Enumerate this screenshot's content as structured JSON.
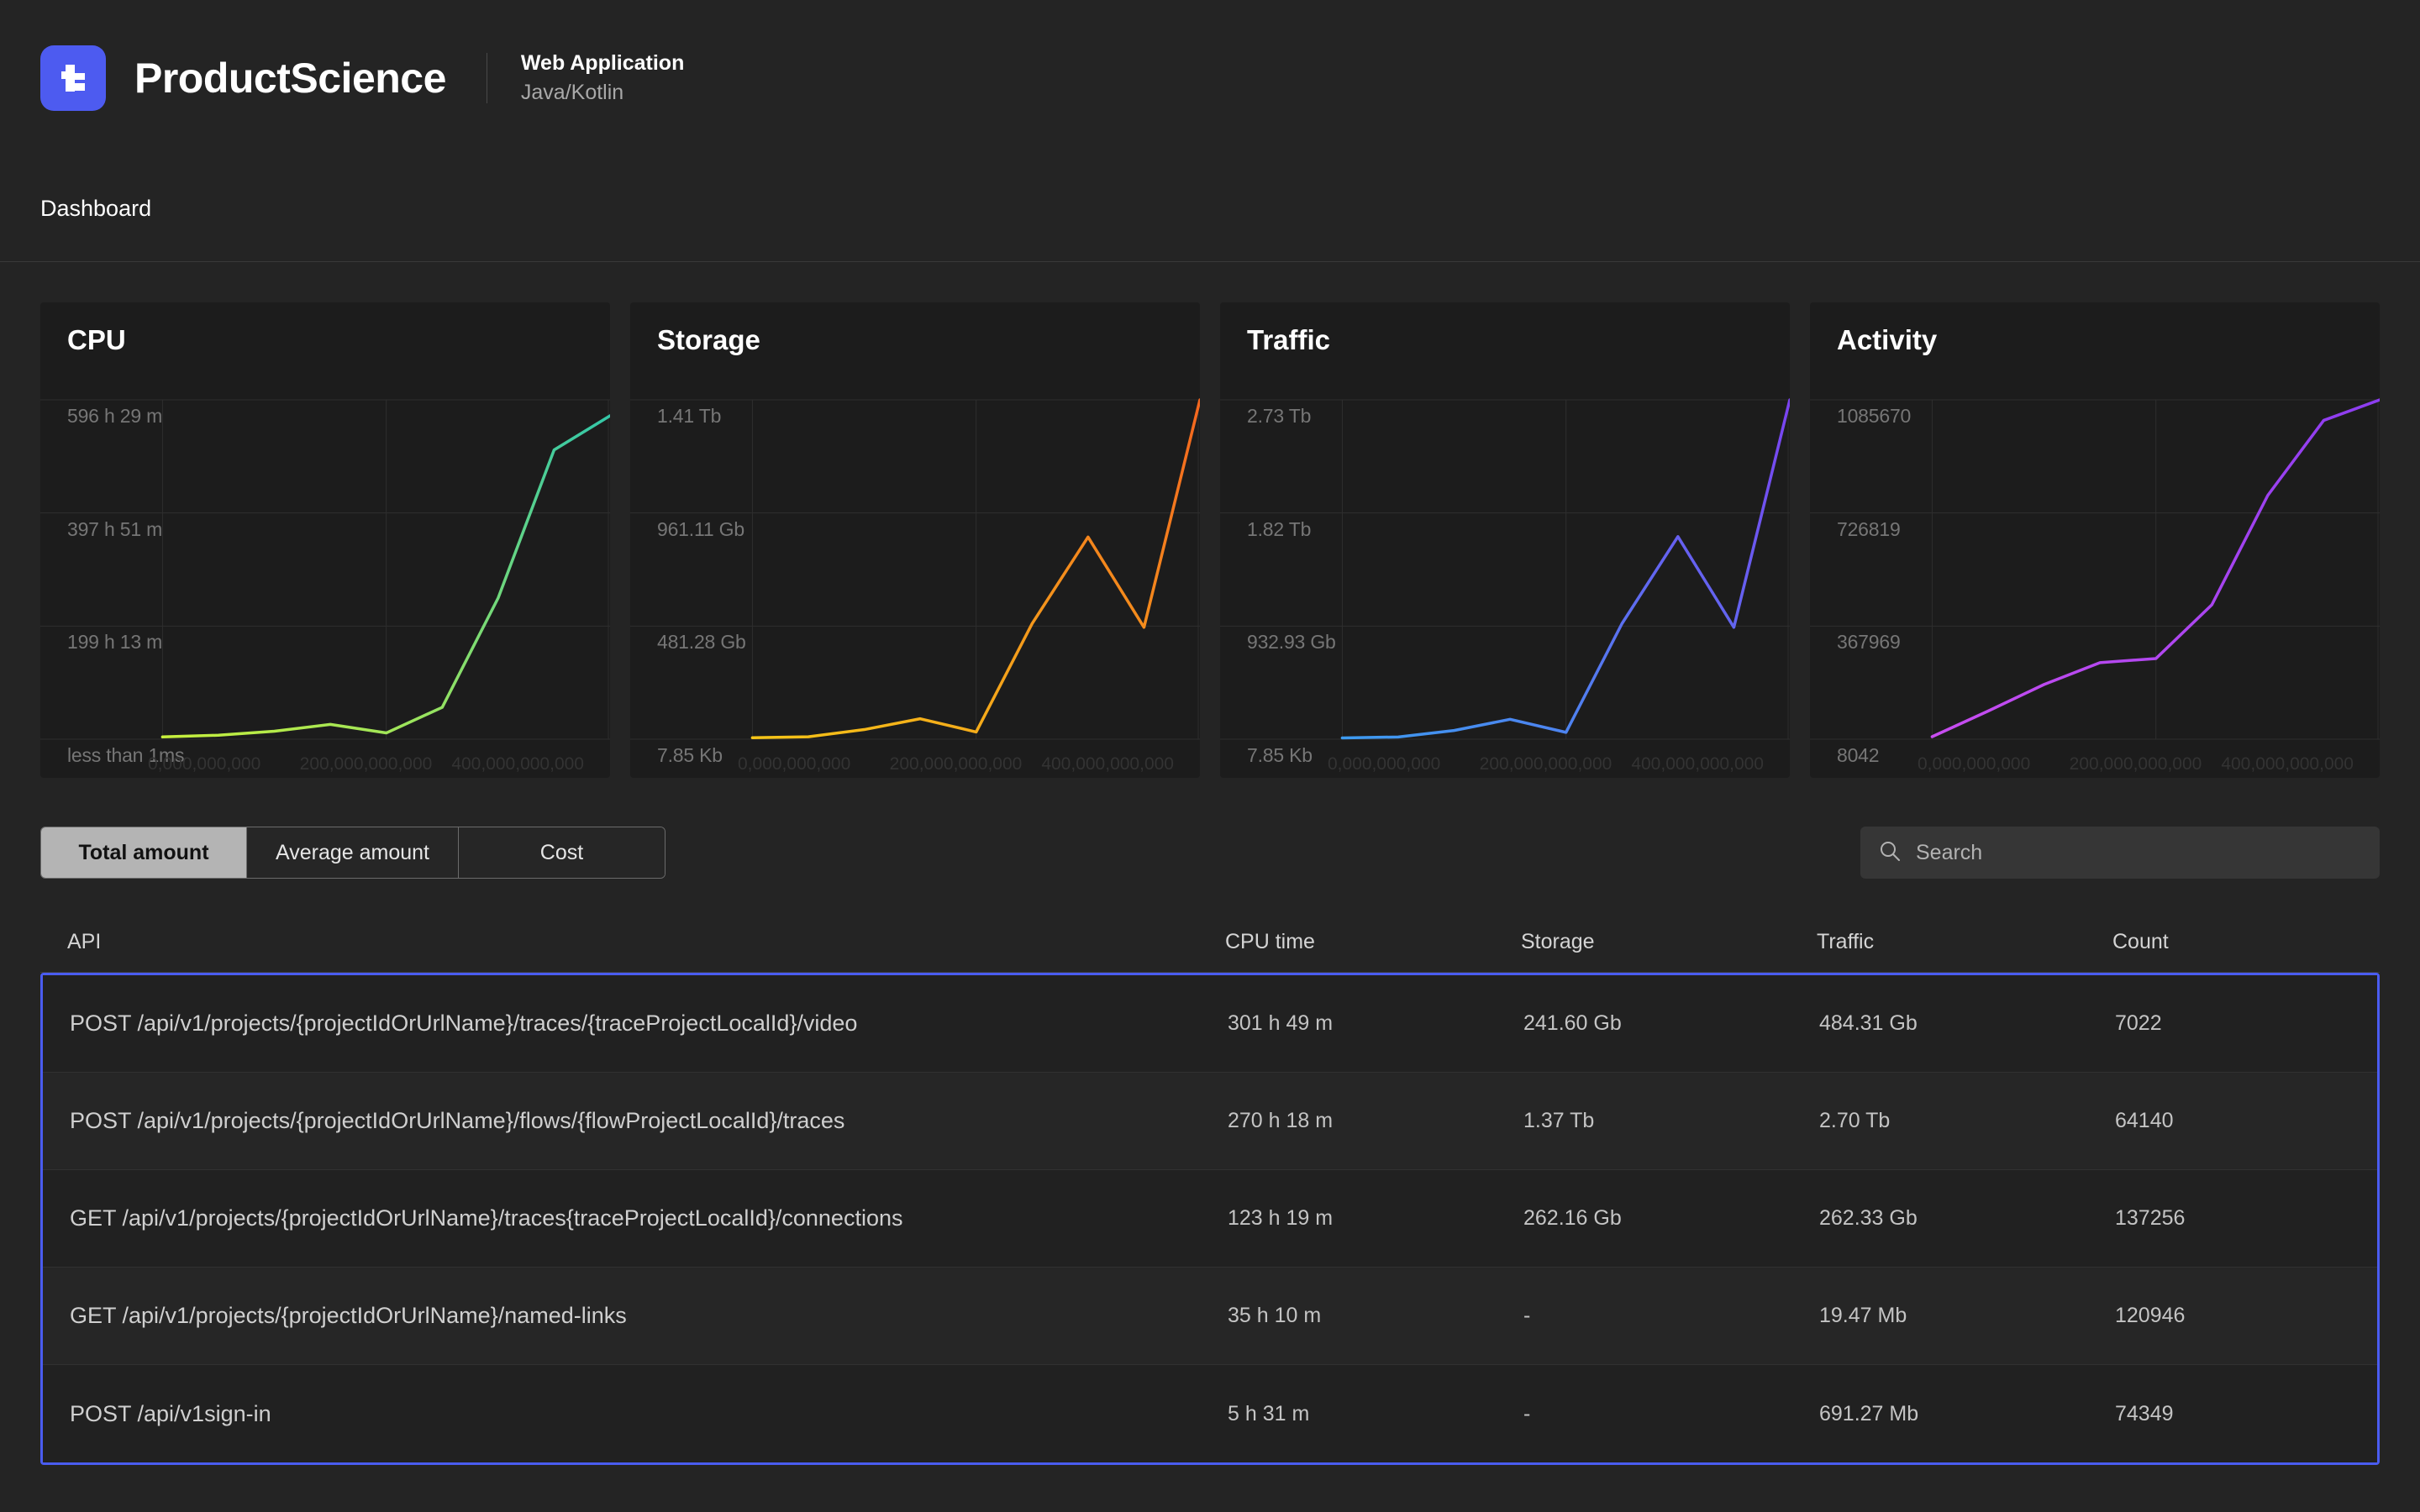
{
  "header": {
    "logo_icon": "productscience-logo-icon",
    "brand": "ProductScience",
    "app_type": "Web Application",
    "tech_stack": "Java/Kotlin"
  },
  "breadcrumb": {
    "label": "Dashboard"
  },
  "colors": {
    "accent": "#4d5bf0",
    "selection_border": "#4a5cf0",
    "page_bg": "#242424",
    "card_bg": "#1c1c1c"
  },
  "chart_data": [
    {
      "type": "line",
      "title": "CPU",
      "ylabel": "",
      "xlabel": "",
      "y_ticks": [
        "less than 1ms",
        "199 h 13 m",
        "397 h 51 m",
        "596 h 29 m"
      ],
      "x_ticks": [
        "0,000,000,000",
        "200,000,000,000",
        "400,000,000,000"
      ],
      "line_start_color": "#c8f03c",
      "line_end_color": "#34c7a8",
      "grid": true,
      "x": [
        0,
        1,
        2,
        3,
        4,
        5,
        6,
        7,
        8
      ],
      "values": [
        4,
        7,
        14,
        26,
        11,
        56,
        248,
        508,
        568
      ],
      "ylim": [
        0,
        596
      ]
    },
    {
      "type": "line",
      "title": "Storage",
      "ylabel": "",
      "xlabel": "",
      "y_ticks": [
        "7.85 Kb",
        "481.28 Gb",
        "961.11 Gb",
        "1.41 Tb"
      ],
      "x_ticks": [
        "0,000,000,000",
        "200,000,000,000",
        "400,000,000,000"
      ],
      "line_start_color": "#f5c518",
      "line_end_color": "#f4661f",
      "grid": true,
      "x": [
        0,
        1,
        2,
        3,
        4,
        5,
        6,
        7,
        8
      ],
      "values": [
        6,
        10,
        40,
        85,
        30,
        480,
        840,
        465,
        1410
      ],
      "ylim": [
        0,
        1410
      ]
    },
    {
      "type": "line",
      "title": "Traffic",
      "ylabel": "",
      "xlabel": "",
      "y_ticks": [
        "7.85 Kb",
        "932.93 Gb",
        "1.82 Tb",
        "2.73 Tb"
      ],
      "x_ticks": [
        "0,000,000,000",
        "200,000,000,000",
        "400,000,000,000"
      ],
      "line_start_color": "#3d9bf0",
      "line_end_color": "#7b42f0",
      "grid": true,
      "x": [
        0,
        1,
        2,
        3,
        4,
        5,
        6,
        7,
        8
      ],
      "values": [
        10,
        18,
        70,
        160,
        55,
        930,
        1630,
        900,
        2730
      ],
      "ylim": [
        0,
        2730
      ]
    },
    {
      "type": "line",
      "title": "Activity",
      "ylabel": "",
      "xlabel": "",
      "y_ticks": [
        "8042",
        "367969",
        "726819",
        "1085670"
      ],
      "x_ticks": [
        "0,000,000,000",
        "200,000,000,000",
        "400,000,000,000"
      ],
      "line_start_color": "#c84df0",
      "line_end_color": "#8c3df0",
      "grid": true,
      "x": [
        0,
        1,
        2,
        3,
        4,
        5,
        6,
        7,
        8
      ],
      "values": [
        8042,
        90000,
        175000,
        245000,
        258000,
        430000,
        780000,
        1020000,
        1085670
      ],
      "ylim": [
        0,
        1085670
      ]
    }
  ],
  "tabs": [
    {
      "label": "Total amount",
      "active": true
    },
    {
      "label": "Average amount",
      "active": false
    },
    {
      "label": "Cost",
      "active": false
    }
  ],
  "search": {
    "icon": "search-icon",
    "placeholder": "Search",
    "value": ""
  },
  "table": {
    "columns": [
      "API",
      "CPU time",
      "Storage",
      "Traffic",
      "Count"
    ],
    "rows": [
      {
        "api": "POST /api/v1/projects/{projectIdOrUrlName}/traces/{traceProjectLocalId}/video",
        "cpu_time": "301 h 49 m",
        "storage": "241.60 Gb",
        "traffic": "484.31 Gb",
        "count": "7022"
      },
      {
        "api": "POST /api/v1/projects/{projectIdOrUrlName}/flows/{flowProjectLocalId}/traces",
        "cpu_time": "270 h 18 m",
        "storage": "1.37 Tb",
        "traffic": "2.70 Tb",
        "count": "64140"
      },
      {
        "api": "GET /api/v1/projects/{projectIdOrUrlName}/traces{traceProjectLocalId}/connections",
        "cpu_time": "123 h 19 m",
        "storage": "262.16 Gb",
        "traffic": "262.33 Gb",
        "count": "137256"
      },
      {
        "api": "GET /api/v1/projects/{projectIdOrUrlName}/named-links",
        "cpu_time": "35 h 10 m",
        "storage": "-",
        "traffic": "19.47 Mb",
        "count": "120946"
      },
      {
        "api": "POST /api/v1sign-in",
        "cpu_time": "5 h 31 m",
        "storage": "-",
        "traffic": "691.27 Mb",
        "count": "74349"
      }
    ]
  }
}
